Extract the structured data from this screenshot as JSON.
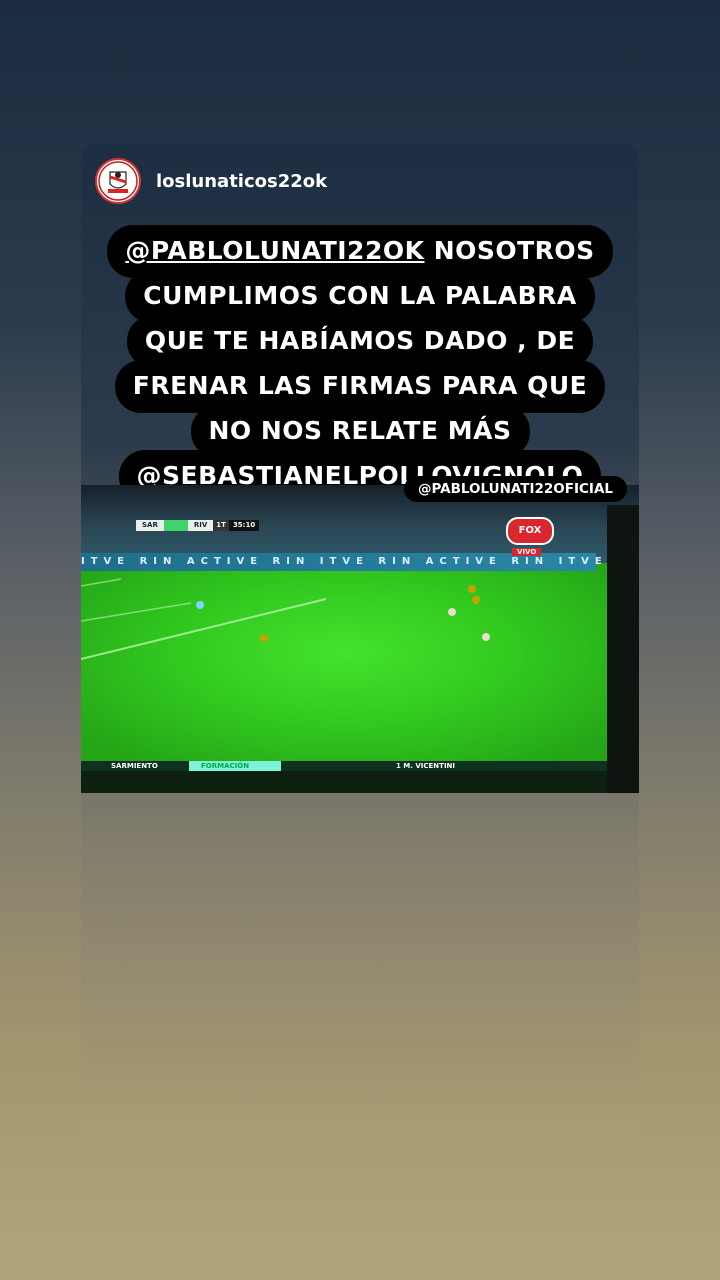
{
  "story": {
    "username": "loslunaticos22ok",
    "avatar_icon": "club-logo-icon",
    "avatar_text": "LOS LUNATICOS RIVER PLATE",
    "caption_lines": [
      {
        "mention": "@PABLOLUNATI22OK",
        "text": "  NOSOTROS"
      },
      {
        "mention": "",
        "text": "CUMPLIMOS CON LA PALABRA"
      },
      {
        "mention": "",
        "text": "QUE TE HABÍAMOS DADO , DE"
      },
      {
        "mention": "",
        "text": "FRENAR LAS FIRMAS PARA QUE"
      },
      {
        "mention": "",
        "text": "NO NOS RELATE MÁS"
      },
      {
        "mention": "@SEBASTIANELPOLLOVIGNOLO",
        "text": ""
      }
    ],
    "tag": "@PABLOLUNATI22OFICIAL"
  },
  "video": {
    "scorebug": {
      "home": "SAR",
      "away": "RIV",
      "half": "1T",
      "time": "35:10"
    },
    "broadcaster": "FOX",
    "live_label": "VIVO",
    "ad_board": "ITVE   RIN   ACTIVE   RIN   ITVE   RIN   ACTIVE   RIN   ITVE",
    "ticker": {
      "team": "SARMIENTO",
      "section": "FORMACIÓN",
      "player": "1 M. VICENTINI"
    }
  },
  "colors": {
    "caption_bg": "#000000",
    "caption_text": "#ffffff",
    "pitch": "#32c91f",
    "fox_red": "#d9272e"
  }
}
